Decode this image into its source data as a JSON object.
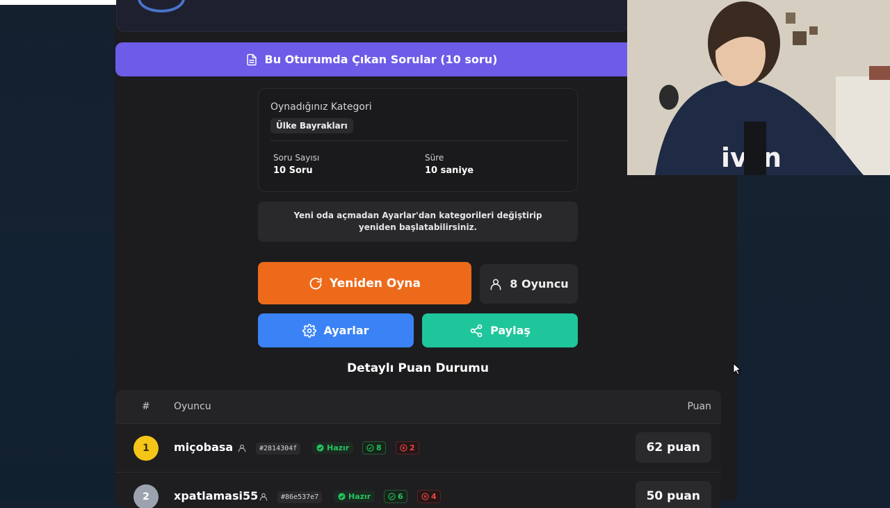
{
  "questions_button": {
    "label": "Bu Oturumda Çıkan Sorular (10 soru)"
  },
  "category_card": {
    "label": "Oynadığınız Kategori",
    "category": "Ülke Bayrakları",
    "stats": [
      {
        "label": "Soru Sayısı",
        "value": "10 Soru"
      },
      {
        "label": "Süre",
        "value": "10 saniye"
      }
    ]
  },
  "notice": "Yeni oda açmadan Ayarlar'dan kategorileri değiştirip yeniden başlatabilirsiniz.",
  "actions": {
    "replay": "Yeniden Oyna",
    "players": "8 Oyuncu",
    "settings": "Ayarlar",
    "share": "Paylaş"
  },
  "scoreboard": {
    "title": "Detaylı Puan Durumu",
    "headers": {
      "rank": "#",
      "player": "Oyuncu",
      "score": "Puan"
    },
    "rows": [
      {
        "rank": "1",
        "name": "miçobasa",
        "id": "#2814304f",
        "status": "Hazır",
        "correct": "8",
        "wrong": "2",
        "score": "62 puan",
        "rank_color": "#f5c518"
      },
      {
        "rank": "2",
        "name": "xpatlamasi55",
        "id": "#86e537e7",
        "status": "Hazır",
        "correct": "6",
        "wrong": "4",
        "score": "50 puan",
        "rank_color": "#9ca3af"
      }
    ]
  },
  "colors": {
    "questions_bar": "#6c5ce7",
    "replay": "#ed6a1b",
    "settings": "#3b82f6",
    "share": "#1fc69b"
  }
}
